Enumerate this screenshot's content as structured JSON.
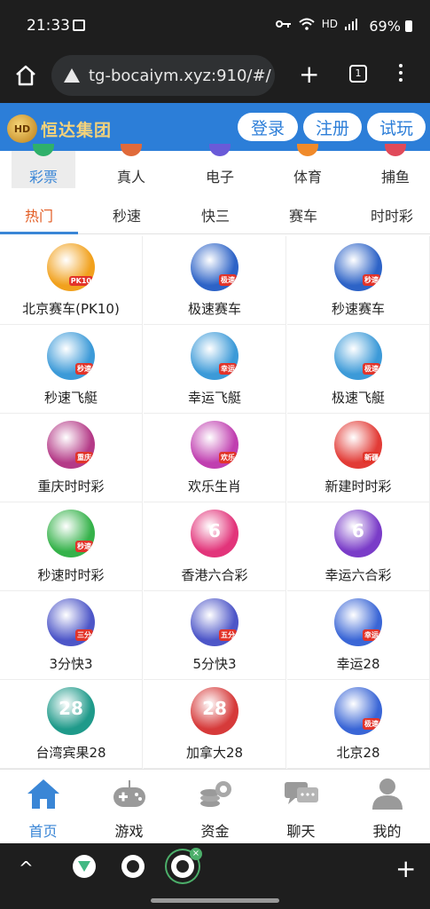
{
  "status_bar": {
    "time": "21:33",
    "network": "HD",
    "battery": "69%"
  },
  "browser": {
    "url": "tg-bocaiym.xyz:910/#/",
    "tab_count": "1"
  },
  "header": {
    "logo_text": "恒达集团",
    "logo_mark": "HD",
    "login": "登录",
    "register": "注册",
    "trial": "试玩"
  },
  "categories": [
    {
      "label": "彩票",
      "icon": "lottery-icon",
      "color": "#2fb06a"
    },
    {
      "label": "真人",
      "icon": "live-icon",
      "color": "#e06a3a"
    },
    {
      "label": "电子",
      "icon": "slot-icon",
      "color": "#6a5ad8"
    },
    {
      "label": "体育",
      "icon": "sports-icon",
      "color": "#f08a2a"
    },
    {
      "label": "捕鱼",
      "icon": "fishing-icon",
      "color": "#e04a5a"
    }
  ],
  "subtabs": [
    "热门",
    "秒速",
    "快三",
    "赛车",
    "时时彩"
  ],
  "games": [
    {
      "name": "北京赛车(PK10)",
      "icon": "pk10-car-icon",
      "color": "#f1a11d",
      "badge": "PK10"
    },
    {
      "name": "极速赛车",
      "icon": "racing-trophy-icon",
      "color": "#2d63c7",
      "badge": "极速"
    },
    {
      "name": "秒速赛车",
      "icon": "racing-trophy-icon",
      "color": "#2d63c7",
      "badge": "秒速"
    },
    {
      "name": "秒速飞艇",
      "icon": "speedboat-icon",
      "color": "#3c9ad8",
      "badge": "秒速"
    },
    {
      "name": "幸运飞艇",
      "icon": "speedboat-icon",
      "color": "#3c9ad8",
      "badge": "幸运"
    },
    {
      "name": "极速飞艇",
      "icon": "speedboat-icon",
      "color": "#3c9ad8",
      "badge": "极速"
    },
    {
      "name": "重庆时时彩",
      "icon": "clock-coins-icon",
      "color": "#b43a87",
      "badge": "重庆"
    },
    {
      "name": "欢乐生肖",
      "icon": "zodiac-icon",
      "color": "#c03fb0",
      "badge": "欢乐"
    },
    {
      "name": "新建时时彩",
      "icon": "ssc-icon",
      "color": "#e23b36",
      "badge": "新疆"
    },
    {
      "name": "秒速时时彩",
      "icon": "clock-coins-icon",
      "color": "#35b24a",
      "badge": "秒速"
    },
    {
      "name": "香港六合彩",
      "icon": "mark-six-icon",
      "color": "#e2347a",
      "badge": "6"
    },
    {
      "name": "幸运六合彩",
      "icon": "mark-six-icon",
      "color": "#7a3cc8",
      "badge": "6"
    },
    {
      "name": "3分快3",
      "icon": "dice-icon",
      "color": "#4d56c8",
      "badge": "三分"
    },
    {
      "name": "5分快3",
      "icon": "dice-icon",
      "color": "#4d56c8",
      "badge": "五分"
    },
    {
      "name": "幸运28",
      "icon": "egg-28-icon",
      "color": "#3a66d6",
      "badge": "幸运"
    },
    {
      "name": "台湾宾果28",
      "icon": "ball-28-icon",
      "color": "#1f9a8a",
      "badge": "28"
    },
    {
      "name": "加拿大28",
      "icon": "ball-28-icon",
      "color": "#d63a3a",
      "badge": "28"
    },
    {
      "name": "北京28",
      "icon": "egg-28-icon",
      "color": "#3a66d6",
      "badge": "极速"
    }
  ],
  "bottom_nav": [
    {
      "label": "首页",
      "icon": "home-icon"
    },
    {
      "label": "游戏",
      "icon": "gamepad-icon"
    },
    {
      "label": "资金",
      "icon": "coins-icon"
    },
    {
      "label": "聊天",
      "icon": "chat-icon"
    },
    {
      "label": "我的",
      "icon": "user-icon"
    }
  ],
  "colors": {
    "brand_blue": "#2c7ed8",
    "accent_orange": "#e25b21",
    "active_blue": "#3a86d6"
  }
}
